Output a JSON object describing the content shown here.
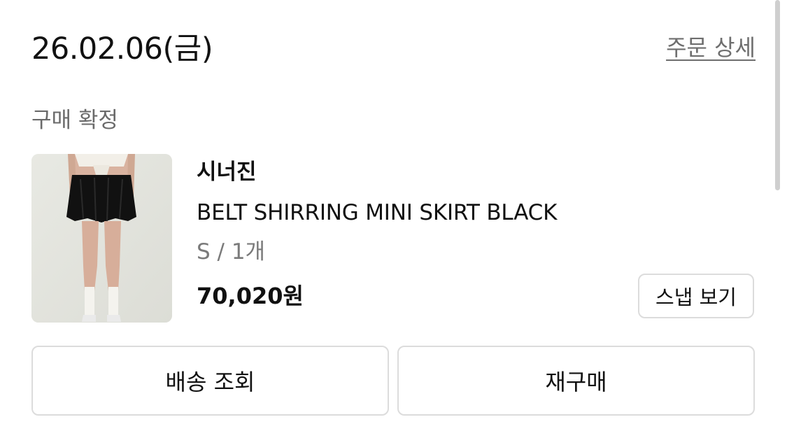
{
  "order": {
    "date": "26.02.06(금)",
    "detail_link": "주문 상세",
    "status": "구매 확정"
  },
  "product": {
    "brand": "시너진",
    "name": "BELT SHIRRING MINI SKIRT BLACK",
    "option": "S / 1개",
    "price": "70,020원",
    "snap_button": "스냅 보기"
  },
  "actions": {
    "track_delivery": "배송 조회",
    "repurchase": "재구매"
  },
  "colors": {
    "text_primary": "#111111",
    "text_secondary": "#6e6e6e",
    "border": "#dcdcdc",
    "background": "#ffffff"
  }
}
